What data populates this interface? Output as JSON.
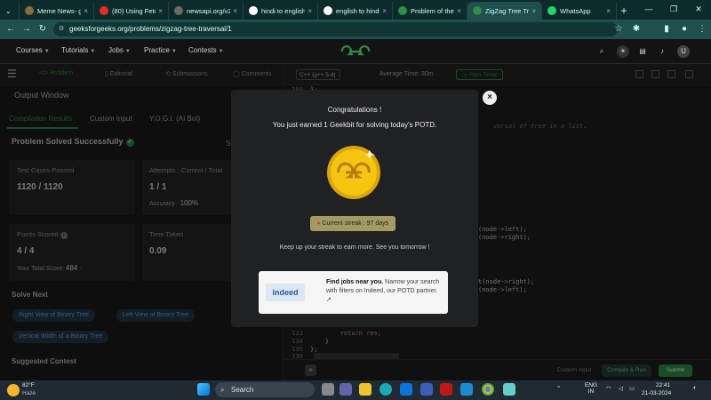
{
  "browser": {
    "tabs": [
      {
        "title": "Meme News- gu",
        "color": "#8a6a3a",
        "icon": "meme-favicon"
      },
      {
        "title": "(80) Using Fetch",
        "color": "#e52d27",
        "icon": "youtube-favicon"
      },
      {
        "title": "newsapi.org/v2/",
        "color": "#6b6b6b",
        "icon": "page-favicon"
      },
      {
        "title": "hindi to english",
        "color": "#ffffff",
        "icon": "google-favicon"
      },
      {
        "title": "english to hindi",
        "color": "#ffffff",
        "icon": "google-favicon"
      },
      {
        "title": "Problem of the D",
        "color": "#2f8d46",
        "icon": "gfg-favicon"
      },
      {
        "title": "ZigZag Tree Trav",
        "color": "#2f8d46",
        "icon": "gfg-favicon",
        "active": true
      },
      {
        "title": "WhatsApp",
        "color": "#25d366",
        "icon": "whatsapp-favicon"
      }
    ],
    "new_tab": "+",
    "url": "geeksforgeeks.org/problems/zigzag-tree-traversal/1"
  },
  "site": {
    "logo": "GfG",
    "nav": [
      "Courses",
      "Tutorials",
      "Jobs",
      "Practice",
      "Contests"
    ],
    "avatar_letter": "U"
  },
  "problem_panel": {
    "tabs": [
      "Problem",
      "Editorial",
      "Submissions",
      "Comments"
    ],
    "output_window": "Output Window",
    "subtabs": [
      "Compilation Results",
      "Custom Input",
      "Y.O.G.I. (AI Bot)"
    ],
    "solved_text": "Problem Solved Successfully",
    "truncated_label": "Su",
    "cards": {
      "test_cases_label": "Test Cases Passed",
      "test_cases_value": "1120 / 1120",
      "attempts_label": "Attempts : Correct / Total",
      "attempts_value": "1 / 1",
      "accuracy_label": "Accuracy :",
      "accuracy_value": "100%",
      "points_label": "Points Scored",
      "points_value": "4 / 4",
      "total_score_label": "Your Total Score:",
      "total_score_value": "484",
      "time_label": "Time Taken",
      "time_value": "0.09"
    },
    "solve_next_title": "Solve Next",
    "solve_next": [
      "Right View of Binary Tree",
      "Left View of Binary Tree",
      "Vertical Width of a Binary Tree"
    ],
    "suggested_contest": "Suggested Contest"
  },
  "editor": {
    "language": "C++ (g++ 5.4)",
    "avg_time": "Average Time: 30m",
    "start_timer": "Start Timer",
    "code": [
      {
        "n": "100",
        "t": "};"
      },
      {
        "n": "",
        "t": "versal of tree in a list."
      },
      {
        "n": "",
        "t": "(node->left);"
      },
      {
        "n": "",
        "t": "(node->right);"
      },
      {
        "n": "",
        "t": "t(node->right);"
      },
      {
        "n": "",
        "t": "(node->left);"
      },
      {
        "n": "133",
        "t": "        return res;"
      },
      {
        "n": "134",
        "t": "    }"
      },
      {
        "n": "135",
        "t": "};"
      },
      {
        "n": "136",
        "t": ""
      }
    ],
    "custom_input": "Custom Input",
    "compile_run": "Compile & Run",
    "submit": "Submit"
  },
  "modal": {
    "title": "Congratulations !",
    "subtitle": "You just earned 1 Geekbit for solving today's POTD.",
    "streak": "Current streak : 97 days",
    "keep_up": "Keep up your streak to earn more. See you tomorrow !",
    "close": "×",
    "ad": {
      "logo": "indeed",
      "headline": "Find jobs near you.",
      "body": "Narrow your search with filters on Indeed, our POTD partner."
    }
  },
  "taskbar": {
    "temp": "82°F",
    "weather": "Haze",
    "search": "Search",
    "lang": "ENG",
    "region": "IN",
    "time": "22:41",
    "date": "21-03-2024"
  }
}
